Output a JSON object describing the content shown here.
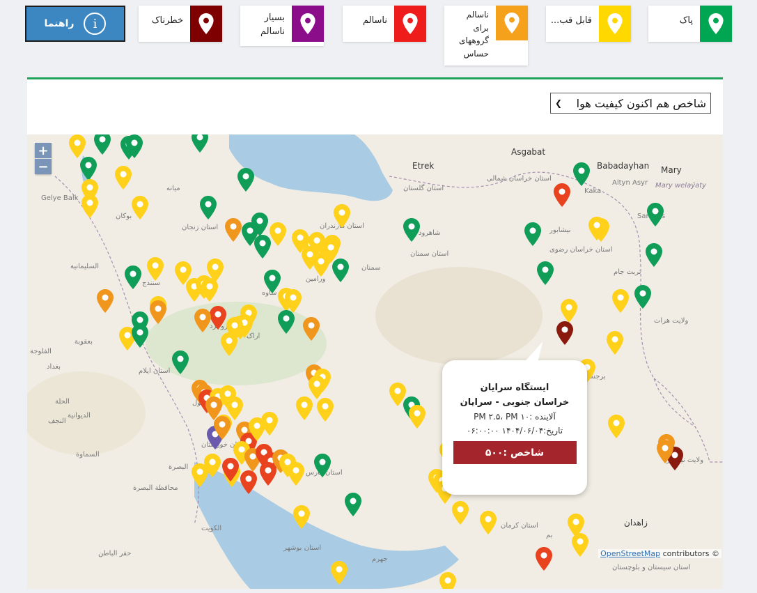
{
  "legend": [
    {
      "label": "پاک",
      "color": "#00a651"
    },
    {
      "label": "قابل قب...",
      "color": "#ffd800"
    },
    {
      "label": "ناسالم\nبرای\nگروههای\nحساس",
      "color": "#f5a11c"
    },
    {
      "label": "ناسالم",
      "color": "#ef1c1c"
    },
    {
      "label": "بسیار\nناسالم",
      "color": "#8b0d8a"
    },
    {
      "label": "خطرناک",
      "color": "#7f0000"
    }
  ],
  "help_button": {
    "label": "راهنما",
    "icon": "info-circle-icon"
  },
  "index_select": {
    "value": "شاخص هم اکنون کیفیت هوا"
  },
  "zoom": {
    "in": "+",
    "out": "−"
  },
  "popup": {
    "title": "ایستگاه سرایان",
    "region": "خراسان جنوبی - سرایان",
    "pollutant": "آلاینده :PM ۲.۵، PM ۱۰",
    "date": "تاریخ:۱۴۰۴/۰۶/۰۴ ۰۶:۰۰:۰۰",
    "index": "شاخص :۵۰۰",
    "color": "#a4262c"
  },
  "attribution": {
    "link": "OpenStreetMap",
    "text": " contributors ©"
  },
  "map_labels": [
    "Asgabat",
    "Babadayhan",
    "Mary",
    "Kaka",
    "Altyn Asyr",
    "Mary welaýaty",
    "Etrek",
    "Gelye Balk",
    "Sarakhs",
    "استان گلستان",
    "استان خراسان شمالی",
    "استان مازندران",
    "استان سمنان",
    "استان خراسان رضوی",
    "نیشابور",
    "سمنان",
    "شاهرود",
    "تربت جام",
    "ولایت هرات",
    "میانه",
    "بوکان",
    "سنندج",
    "استان زنجان",
    "ورامین",
    "ساوه",
    "بروجرد",
    "اراک",
    "استان ایلام",
    "دزفول",
    "استان خوزستان",
    "البصرة",
    "محافظة البصرة",
    "الکویت",
    "حفر الباطن",
    "بغداد",
    "الحلة",
    "الديوانية",
    "النجف",
    "السماوة",
    "الفلوجة",
    "بعقوبة",
    "السليمانية",
    "استان فارس",
    "استان بوشهر",
    "استان کرمان",
    "استان سیستان و بلوچستان",
    "زاهدان",
    "بم",
    "جهرم",
    "برجند",
    "ولایت نیمروز"
  ]
}
